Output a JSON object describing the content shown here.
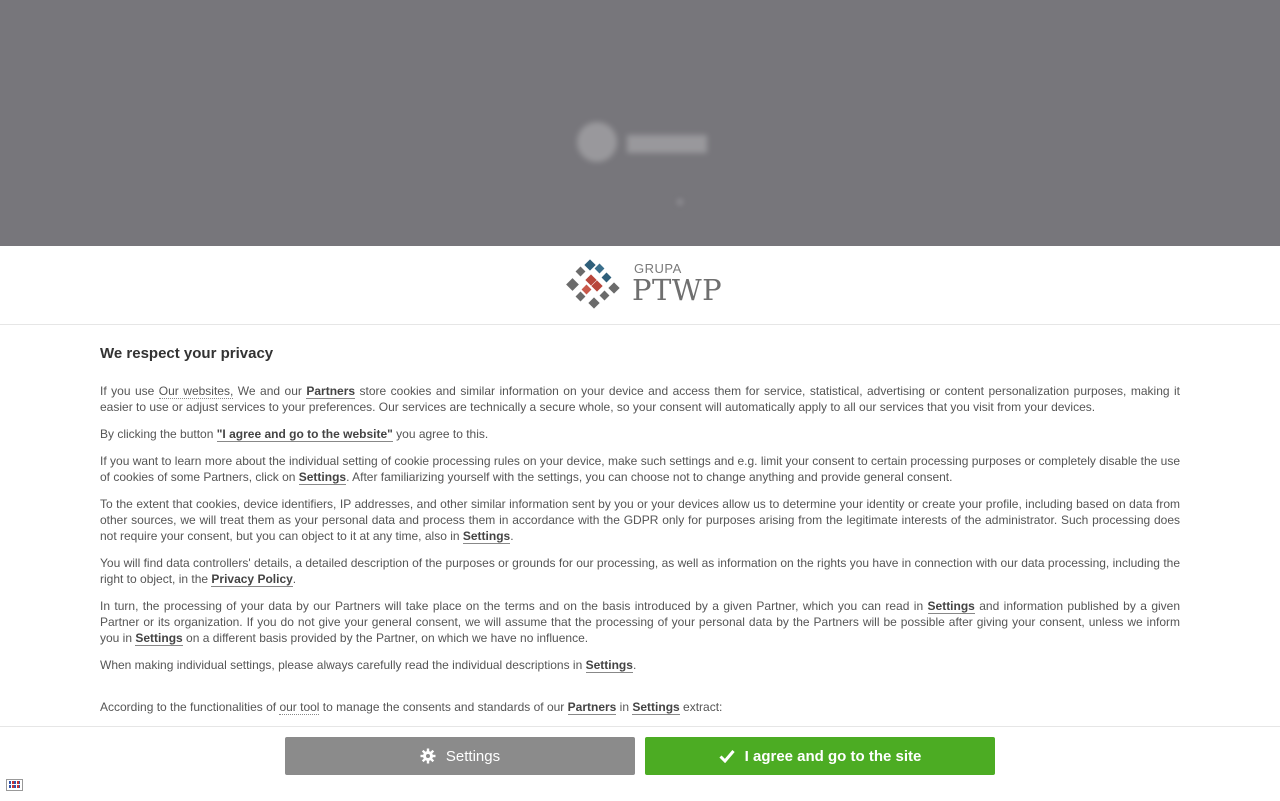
{
  "logo": {
    "top": "GRUPA",
    "name": "PTWP"
  },
  "title": "We respect your privacy",
  "p1": {
    "a": "If you use ",
    "link_websites": "Our websites,",
    "b": " We and our ",
    "link_partners": "Partners",
    "c": " store cookies and similar information on your device and access them for service, statistical, advertising or content personalization purposes, making it easier to use or adjust services to your preferences. Our services are technically a secure whole, so your consent will automatically apply to all our services that you visit from your devices."
  },
  "p2": {
    "a": "By clicking the button ",
    "link": "\"I agree and go to the website\"",
    "b": " you agree to this."
  },
  "p3": {
    "a": "If you want to learn more about the individual setting of cookie processing rules on your device, make such settings and e.g. limit your consent to certain processing purposes or completely disable the use of cookies of some Partners, click on ",
    "link": "Settings",
    "b": ". After familiarizing yourself with the settings, you can choose not to change anything and provide general consent."
  },
  "p4": {
    "a": "To the extent that cookies, device identifiers, IP addresses, and other similar information sent by you or your devices allow us to determine your identity or create your profile, including based on data from other sources, we will treat them as your personal data and process them in accordance with the GDPR only for purposes arising from the legitimate interests of the administrator. Such processing does not require your consent, but you can object to it at any time, also in ",
    "link": "Settings",
    "b": "."
  },
  "p5": {
    "a": "You will find data controllers' details, a detailed description of the purposes or grounds for our processing, as well as information on the rights you have in connection with our data processing, including the right to object, in the ",
    "link": "Privacy Policy",
    "b": "."
  },
  "p6": {
    "a": "In turn, the processing of your data by our Partners will take place on the terms and on the basis introduced by a given Partner, which you can read in ",
    "link1": "Settings",
    "b": " and information published by a given Partner or its organization. If you do not give your general consent, we will assume that the processing of your personal data by the Partners will be possible after giving your consent, unless we inform you in ",
    "link2": "Settings",
    "c": " on a different basis provided by the Partner, on which we have no influence."
  },
  "p7": {
    "a": "When making individual settings, please always carefully read the individual descriptions in ",
    "link": "Settings",
    "b": "."
  },
  "p8": {
    "a": "According to the functionalities of ",
    "link_tool": "our tool",
    "b": " to manage the consents and standards of our ",
    "link_partners": "Partners",
    "c": " in ",
    "link_settings": "Settings",
    "d": " extract:"
  },
  "buttons": {
    "settings": "Settings",
    "agree": "I agree and go to the site"
  },
  "icons": {
    "settings": "gear-icon",
    "agree": "checkmark-icon",
    "language": "flag-icon"
  },
  "colors": {
    "agree_button": "#4cac23",
    "settings_button": "#8b8b8b",
    "backdrop": "#77767b"
  }
}
